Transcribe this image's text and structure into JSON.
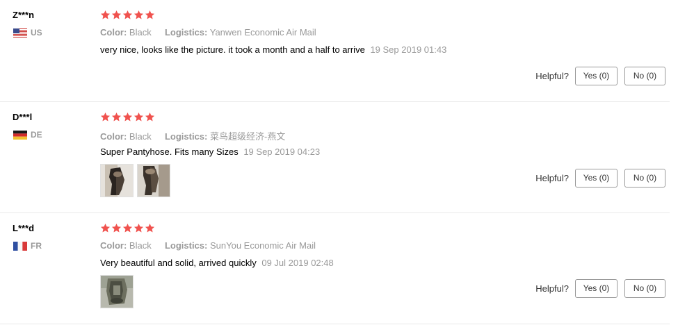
{
  "helpful_label": "Helpful?",
  "colors": {
    "star": "#f0524e",
    "muted": "#999999",
    "divider": "#e8e8e8"
  },
  "reviews": [
    {
      "user": "Z***n",
      "country": "US",
      "flag_icon": "us-flag-icon",
      "rating": 5,
      "color_key": "Color:",
      "color_value": "Black",
      "logistics_key": "Logistics:",
      "logistics_value": "Yanwen Economic Air Mail",
      "text": "very nice, looks like the picture. it took a month and a half to arrive",
      "time": "19 Sep 2019 01:43",
      "photos": [],
      "yes_label": "Yes (0)",
      "no_label": "No (0)"
    },
    {
      "user": "D***l",
      "country": "DE",
      "flag_icon": "de-flag-icon",
      "rating": 5,
      "color_key": "Color:",
      "color_value": "Black",
      "logistics_key": "Logistics:",
      "logistics_value": "菜鸟超级经济-燕文",
      "text": "Super Pantyhose. Fits many Sizes",
      "time": "19 Sep 2019 04:23",
      "photos": [
        "review-photo",
        "review-photo"
      ],
      "yes_label": "Yes (0)",
      "no_label": "No (0)"
    },
    {
      "user": "L***d",
      "country": "FR",
      "flag_icon": "fr-flag-icon",
      "rating": 5,
      "color_key": "Color:",
      "color_value": "Black",
      "logistics_key": "Logistics:",
      "logistics_value": "SunYou Economic Air Mail",
      "text": "Very beautiful and solid, arrived quickly",
      "time": "09 Jul 2019 02:48",
      "photos": [
        "review-photo"
      ],
      "yes_label": "Yes (0)",
      "no_label": "No (0)"
    }
  ]
}
